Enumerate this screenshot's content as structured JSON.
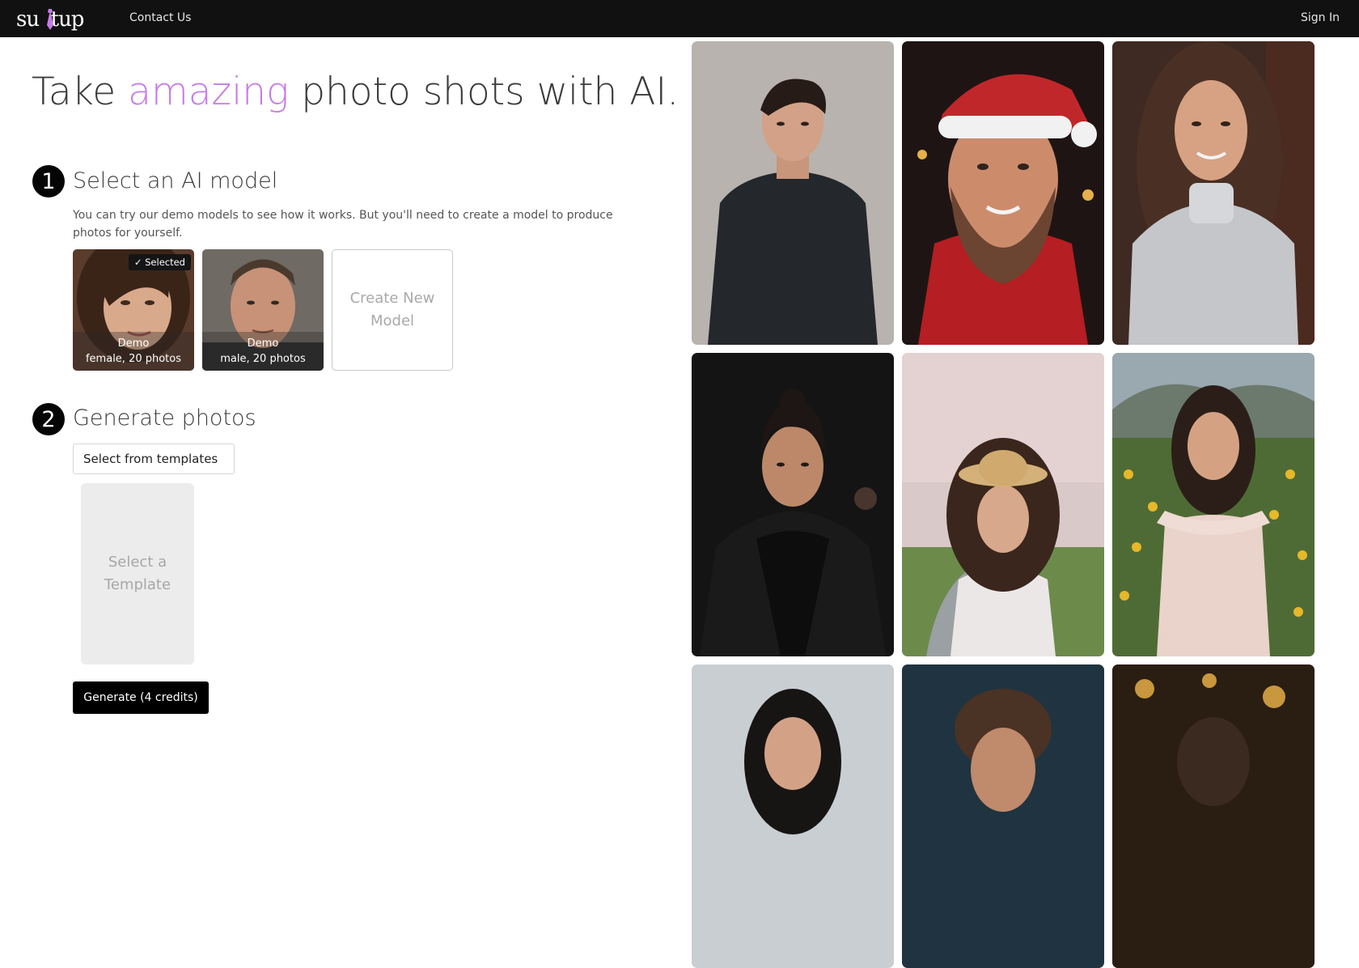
{
  "header": {
    "logo_alt": "suitup",
    "contact_label": "Contact Us",
    "signin_label": "Sign In"
  },
  "headline": {
    "before": "Take ",
    "accent": "amazing",
    "after": " photo shots with AI."
  },
  "step1": {
    "number": "1",
    "title": "Select an AI model",
    "description": "You can try our demo models to see how it works. But you'll need to create a model to produce photos for yourself.",
    "models": [
      {
        "name": "Demo",
        "detail": "female, 20 photos",
        "selected": true,
        "badge": "✓ Selected"
      },
      {
        "name": "Demo",
        "detail": "male, 20 photos",
        "selected": false
      }
    ],
    "create_label": "Create New Model"
  },
  "step2": {
    "number": "2",
    "title": "Generate photos",
    "template_select": "Select from templates",
    "template_placeholder": "Select a Template",
    "generate_label": "Generate (4 credits)"
  },
  "gallery": [
    {
      "subject": "young man in dark t-shirt"
    },
    {
      "subject": "bearded man in santa hat"
    },
    {
      "subject": "woman in silver turtleneck"
    },
    {
      "subject": "woman in black jacket"
    },
    {
      "subject": "woman in straw hat under cherry blossoms"
    },
    {
      "subject": "woman in floral dress in flower field"
    },
    {
      "subject": "woman portrait"
    },
    {
      "subject": "man portrait"
    },
    {
      "subject": "portrait with bokeh lights"
    }
  ],
  "colors": {
    "topbar": "#111111",
    "accent": "#c77ce8",
    "button": "#000000"
  }
}
